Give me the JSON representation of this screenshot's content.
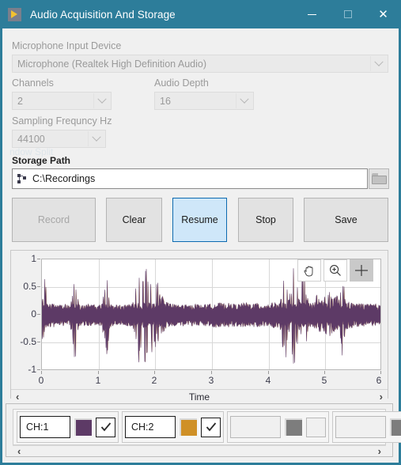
{
  "window": {
    "title": "Audio Acquisition And Storage",
    "icon": "labview-run-icon",
    "titlebar_color": "#2d7d9a",
    "controls": {
      "minimize": "minimize-icon",
      "maximize": "maximize-icon",
      "close": "close-icon"
    }
  },
  "form": {
    "mic_label": "Microphone Input Device",
    "mic_value": "Microphone (Realtek High Definition Audio)",
    "channels_label": "Channels",
    "channels_value": "2",
    "depth_label": "Audio Depth",
    "depth_value": "16",
    "sampling_label": "Sampling Frequncy Hz",
    "sampling_value": "44100",
    "ghost_label": "ndow Split",
    "storage_label": "Storage Path",
    "storage_value": "C:\\Recordings",
    "browse_icon": "folder-icon"
  },
  "buttons": [
    {
      "label": "Record",
      "state": "disabled"
    },
    {
      "label": "Clear",
      "state": "normal"
    },
    {
      "label": "Resume",
      "state": "hover"
    },
    {
      "label": "Stop",
      "state": "normal"
    },
    {
      "label": "Save",
      "state": "normal"
    }
  ],
  "graph": {
    "tools": [
      {
        "name": "pan-hand-icon",
        "selected": false
      },
      {
        "name": "zoom-magnifier-icon",
        "selected": false
      },
      {
        "name": "crosshair-cursor-icon",
        "selected": true
      }
    ],
    "xscroll_left": "‹",
    "xscroll_right": "›"
  },
  "chart_data": {
    "type": "line",
    "title": "",
    "xlabel": "Time",
    "ylabel": "",
    "xlim": [
      0,
      6
    ],
    "ylim": [
      -1,
      1
    ],
    "xticks": [
      "0",
      "1",
      "2",
      "3",
      "4",
      "5",
      "6"
    ],
    "yticks": [
      "1",
      "0.5",
      "0",
      "-0.5",
      "-1"
    ],
    "grid": true,
    "legend_position": "bottom",
    "series": [
      {
        "name": "CH:1",
        "color": "#5d3a66",
        "visible": true,
        "description": "Audio waveform, dense noise band ~±0.15 with transient spikes",
        "envelope_x": [
          0.0,
          0.05,
          0.1,
          0.2,
          0.3,
          0.4,
          0.5,
          0.58,
          0.65,
          0.75,
          0.85,
          0.95,
          1.05,
          1.15,
          1.2,
          1.3,
          1.4,
          1.5,
          1.6,
          1.65,
          1.7,
          1.75,
          1.8,
          1.85,
          1.9,
          1.95,
          2.05,
          2.1,
          2.2,
          2.3,
          2.4,
          2.5,
          2.6,
          2.7,
          2.8,
          2.9,
          3.0,
          3.1,
          3.2,
          3.3,
          3.4,
          3.5,
          3.6,
          3.7,
          3.8,
          3.9,
          4.0,
          4.1,
          4.2,
          4.3,
          4.35,
          4.45,
          4.55,
          4.6,
          4.7,
          4.8,
          4.85,
          4.95,
          5.05,
          5.15,
          5.25,
          5.3,
          5.35,
          5.45,
          5.55,
          5.65,
          5.75,
          5.85,
          5.95,
          6.0
        ],
        "envelope_top": [
          0.18,
          0.72,
          0.2,
          0.22,
          0.18,
          0.2,
          0.17,
          0.82,
          0.19,
          0.18,
          0.2,
          0.17,
          0.19,
          0.65,
          0.2,
          0.18,
          0.17,
          0.19,
          0.2,
          0.62,
          0.97,
          0.88,
          1.0,
          0.92,
          0.85,
          0.6,
          0.58,
          0.4,
          0.22,
          0.2,
          0.18,
          0.19,
          0.17,
          0.2,
          0.18,
          0.19,
          0.2,
          0.22,
          0.2,
          0.21,
          0.19,
          0.2,
          0.22,
          0.2,
          0.21,
          0.19,
          0.2,
          0.22,
          0.21,
          0.99,
          0.22,
          0.99,
          0.2,
          0.99,
          0.22,
          0.21,
          0.4,
          0.23,
          0.45,
          0.3,
          0.38,
          0.99,
          0.25,
          0.22,
          0.2,
          0.21,
          0.19,
          0.2,
          0.18,
          0.17
        ],
        "envelope_bottom": [
          -0.7,
          -0.22,
          -0.2,
          -0.21,
          -0.18,
          -0.2,
          -0.17,
          -0.98,
          -0.19,
          -0.18,
          -0.2,
          -0.17,
          -0.19,
          -0.8,
          -0.2,
          -0.18,
          -0.17,
          -0.19,
          -0.2,
          -0.62,
          -1.0,
          -0.95,
          -1.0,
          -1.0,
          -0.98,
          -0.6,
          -0.55,
          -0.4,
          -0.22,
          -0.2,
          -0.18,
          -0.19,
          -0.17,
          -0.2,
          -0.18,
          -0.19,
          -0.2,
          -0.22,
          -0.2,
          -0.21,
          -0.19,
          -0.2,
          -0.22,
          -0.2,
          -0.21,
          -0.19,
          -0.2,
          -0.22,
          -0.21,
          -1.0,
          -0.22,
          -1.0,
          -0.2,
          -1.0,
          -0.22,
          -0.21,
          -0.4,
          -0.23,
          -0.45,
          -0.3,
          -0.38,
          -1.0,
          -0.25,
          -0.22,
          -0.2,
          -0.21,
          -0.19,
          -0.2,
          -0.18,
          -0.17
        ]
      },
      {
        "name": "CH:2",
        "color": "#cf9026",
        "visible": true,
        "description": "Second channel, nearly coincident with CH:1, mostly hidden"
      }
    ]
  },
  "legend": {
    "channels": [
      {
        "label": "CH:1",
        "color": "#5d3a66",
        "checked": true,
        "empty": false
      },
      {
        "label": "CH:2",
        "color": "#cf9026",
        "checked": true,
        "empty": false
      },
      {
        "label": "",
        "color": "#7d7d7d",
        "checked": false,
        "empty": true
      },
      {
        "label": "",
        "color": "#7d7d7d",
        "checked": false,
        "empty": true
      }
    ],
    "scroll_left": "‹",
    "scroll_right": "›"
  }
}
